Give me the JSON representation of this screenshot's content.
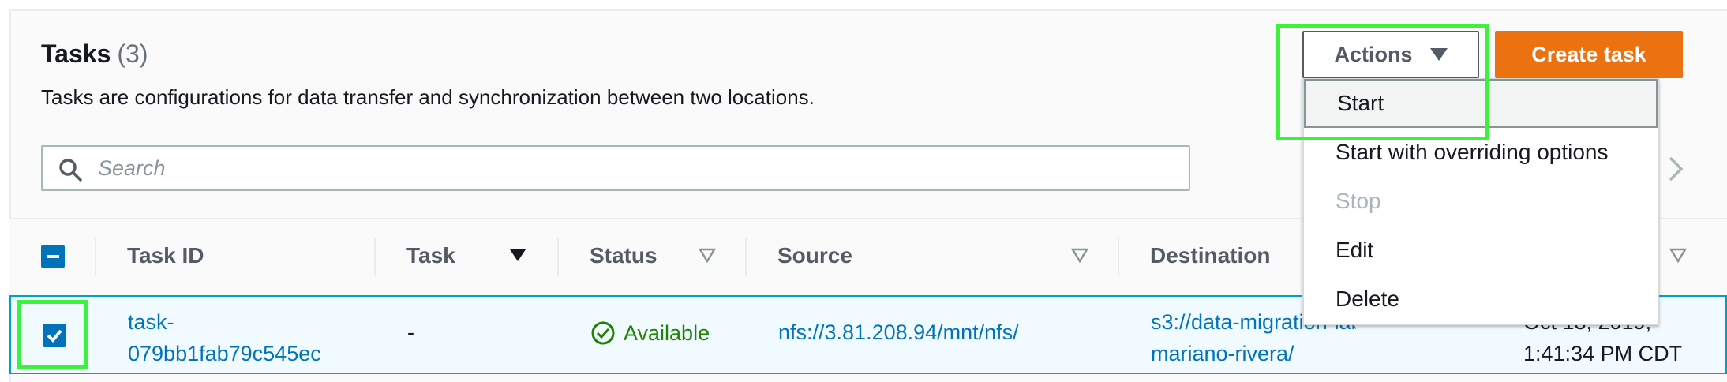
{
  "header": {
    "title": "Tasks",
    "count": "(3)",
    "description": "Tasks are configurations for data transfer and synchronization between two locations."
  },
  "search": {
    "placeholder": "Search",
    "value": ""
  },
  "buttons": {
    "actions_label": "Actions",
    "create_label": "Create task"
  },
  "actions_menu": {
    "items": [
      {
        "label": "Start",
        "state": "highlighted"
      },
      {
        "label": "Start with overriding options",
        "state": "enabled"
      },
      {
        "label": "Stop",
        "state": "disabled"
      },
      {
        "label": "Edit",
        "state": "enabled"
      },
      {
        "label": "Delete",
        "state": "enabled"
      }
    ]
  },
  "table": {
    "columns": [
      "Task ID",
      "Task",
      "Status",
      "Source",
      "Destination"
    ],
    "rows": [
      {
        "selected": true,
        "task_id_line1": "task-",
        "task_id_line2": "079bb1fab79c545ec",
        "task": "-",
        "status": "Available",
        "source": "nfs://3.81.208.94/mnt/nfs/",
        "destination_line1": "s3://data-migration-lab",
        "destination_line2": "mariano-rivera/",
        "created_line1": "Oct 13, 2019,",
        "created_line2": "1:41:34 PM CDT"
      }
    ]
  },
  "colors": {
    "accent": "#0073bb",
    "primary_button": "#ec7211",
    "status_available": "#1d8102",
    "annotation_highlight": "#3cf23c"
  },
  "icons": [
    "search-icon",
    "caret-down-icon",
    "sort-descending-icon",
    "sort-icon",
    "check-circle-icon",
    "checkbox-checked-icon",
    "checkbox-indeterminate-icon",
    "chevron-right-icon"
  ]
}
